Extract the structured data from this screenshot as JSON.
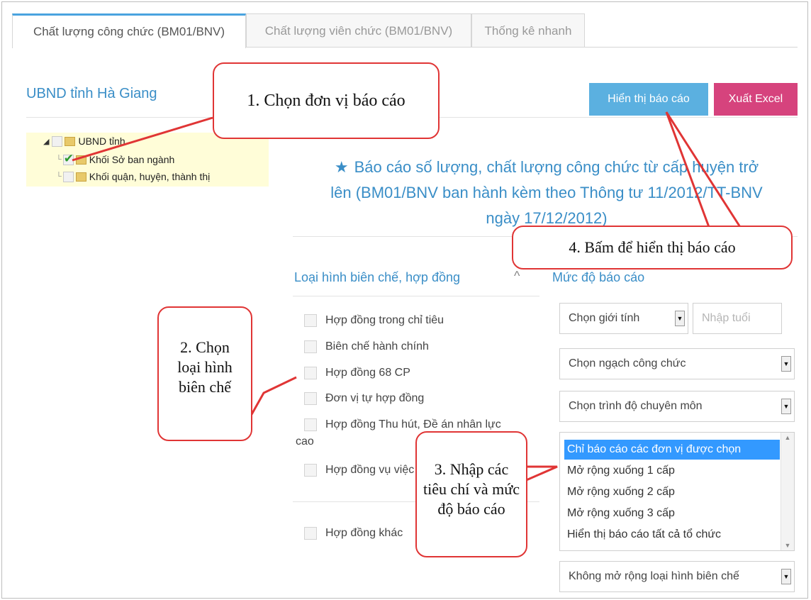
{
  "tabs": [
    "Chất lượng công chức (BM01/BNV)",
    "Chất lượng viên chức (BM01/BNV)",
    "Thống kê nhanh"
  ],
  "unit_title": "UBND tỉnh Hà Giang",
  "buttons": {
    "show": "Hiển thị báo cáo",
    "export": "Xuất Excel",
    "show_color": "#5bb0e0",
    "export_color": "#d6437d"
  },
  "tree": {
    "root": "UBND tỉnh ",
    "items": [
      "Khối Sở ban ngành",
      "Khối quận, huyện, thành thị"
    ]
  },
  "report_title": {
    "icon": "★",
    "lines": [
      "Báo cáo số lượng, chất lượng công chức từ cấp huyện trở",
      "lên (BM01/BNV ban hành kèm theo Thông tư 11/2012/TT-BNV",
      "ngày 17/12/2012)"
    ]
  },
  "section_left": "Loại hình biên chế, hợp đồng",
  "section_right": "Mức độ báo cáo",
  "options": [
    "Hợp đồng trong chỉ tiêu",
    "Biên chế hành chính",
    "Hợp đồng 68 CP",
    "Đơn vị tự hợp đồng",
    "Hợp đồng Thu hút, Đề án nhân lực",
    "cao",
    "Hợp đồng vụ việc",
    "Hợp đồng khác"
  ],
  "selects": {
    "gender": "Chọn giới tính",
    "age_placeholder": "Nhập tuổi",
    "rank": "Chọn ngạch công chức",
    "level": "Chọn trình độ chuyên môn",
    "expand": "Không mở rộng loại hình biên chế"
  },
  "listbox": [
    "Chỉ báo cáo các đơn vị được chọn",
    "Mở rộng xuống 1 cấp",
    "Mở rộng xuống 2 cấp",
    "Mở rộng xuống 3 cấp",
    "Hiển thị báo cáo tất cả tổ chức"
  ],
  "callouts": {
    "c1": "1. Chọn đơn vị báo cáo",
    "c2": [
      "2. Chọn",
      "loại hình",
      "biên chế"
    ],
    "c3": [
      "3. Nhập các",
      "tiêu chí và mức",
      "độ báo cáo"
    ],
    "c4": "4. Bấm để hiển thị báo cáo"
  },
  "colors": {
    "accent": "#3a8ec7",
    "callout_border": "#e03535",
    "tree_bg": "#fffdd8"
  }
}
